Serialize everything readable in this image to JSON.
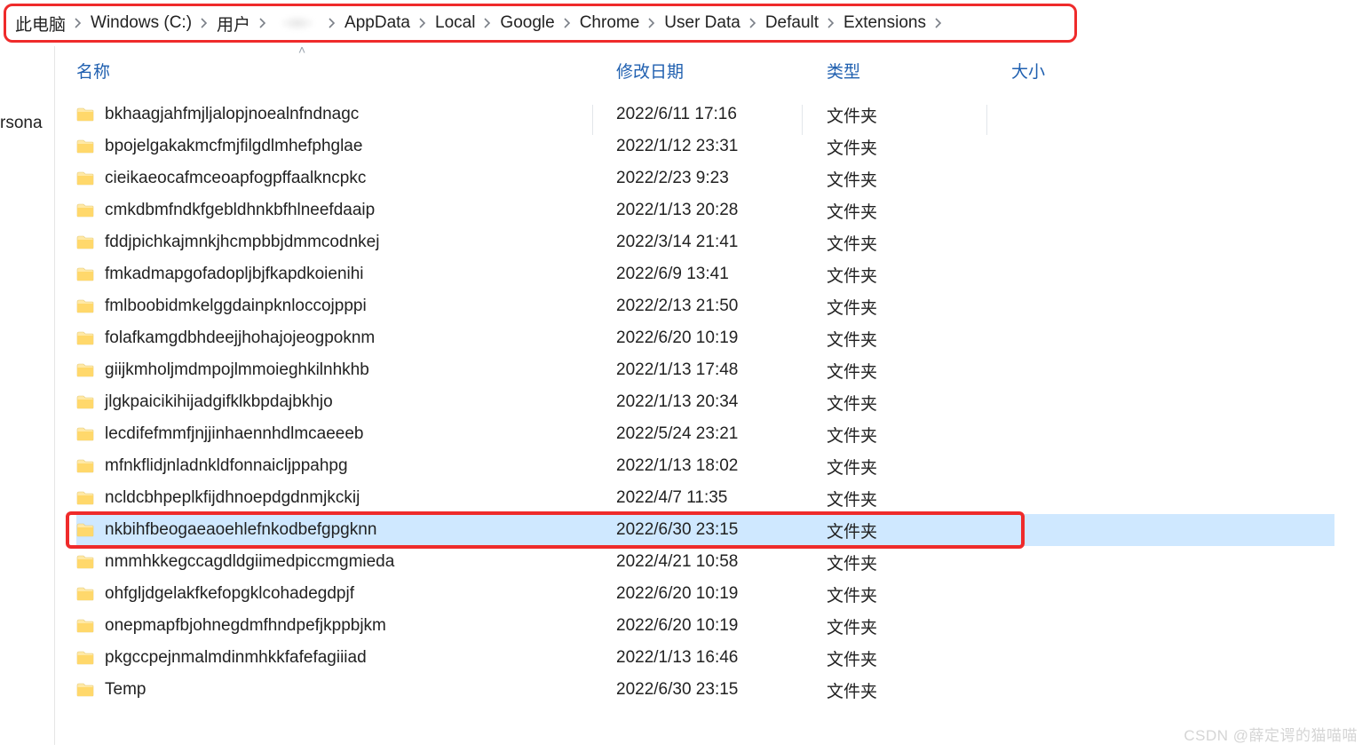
{
  "breadcrumb": [
    "此电脑",
    "Windows (C:)",
    "用户",
    "",
    "AppData",
    "Local",
    "Google",
    "Chrome",
    "User Data",
    "Default",
    "Extensions"
  ],
  "sidebar": {
    "item_partial": "rsona"
  },
  "columns": {
    "name": "名称",
    "date": "修改日期",
    "type": "类型",
    "size": "大小"
  },
  "rows": [
    {
      "name": "bkhaagjahfmjljalopjnoealnfndnagc",
      "date": "2022/6/11 17:16",
      "type": "文件夹",
      "selected": false
    },
    {
      "name": "bpojelgakakmcfmjfilgdlmhefphglae",
      "date": "2022/1/12 23:31",
      "type": "文件夹",
      "selected": false
    },
    {
      "name": "cieikaeocafmceoapfogpffaalkncpkc",
      "date": "2022/2/23 9:23",
      "type": "文件夹",
      "selected": false
    },
    {
      "name": "cmkdbmfndkfgebldhnkbfhlneefdaaip",
      "date": "2022/1/13 20:28",
      "type": "文件夹",
      "selected": false
    },
    {
      "name": "fddjpichkajmnkjhcmpbbjdmmcodnkej",
      "date": "2022/3/14 21:41",
      "type": "文件夹",
      "selected": false
    },
    {
      "name": "fmkadmapgofadopljbjfkapdkoienihi",
      "date": "2022/6/9 13:41",
      "type": "文件夹",
      "selected": false
    },
    {
      "name": "fmlboobidmkelggdainpknloccojpppi",
      "date": "2022/2/13 21:50",
      "type": "文件夹",
      "selected": false
    },
    {
      "name": "folafkamgdbhdeejjhohajojeogpoknm",
      "date": "2022/6/20 10:19",
      "type": "文件夹",
      "selected": false
    },
    {
      "name": "giijkmholjmdmpojlmmoieghkilnhkhb",
      "date": "2022/1/13 17:48",
      "type": "文件夹",
      "selected": false
    },
    {
      "name": "jlgkpaicikihijadgifklkbpdajbkhjo",
      "date": "2022/1/13 20:34",
      "type": "文件夹",
      "selected": false
    },
    {
      "name": "lecdifefmmfjnjjinhaennhdlmcaeeeb",
      "date": "2022/5/24 23:21",
      "type": "文件夹",
      "selected": false
    },
    {
      "name": "mfnkflidjnladnkldfonnaicljppahpg",
      "date": "2022/1/13 18:02",
      "type": "文件夹",
      "selected": false
    },
    {
      "name": "ncldcbhpeplkfijdhnoepdgdnmjkckij",
      "date": "2022/4/7 11:35",
      "type": "文件夹",
      "selected": false
    },
    {
      "name": "nkbihfbeogaeaoehlefnkodbefgpgknn",
      "date": "2022/6/30 23:15",
      "type": "文件夹",
      "selected": true
    },
    {
      "name": "nmmhkkegccagdldgiimedpiccmgmieda",
      "date": "2022/4/21 10:58",
      "type": "文件夹",
      "selected": false
    },
    {
      "name": "ohfgljdgelakfkefopgklcohadegdpjf",
      "date": "2022/6/20 10:19",
      "type": "文件夹",
      "selected": false
    },
    {
      "name": "onepmapfbjohnegdmfhndpefjkppbjkm",
      "date": "2022/6/20 10:19",
      "type": "文件夹",
      "selected": false
    },
    {
      "name": "pkgccpejnmalmdinmhkkfafefagiiiad",
      "date": "2022/1/13 16:46",
      "type": "文件夹",
      "selected": false
    },
    {
      "name": "Temp",
      "date": "2022/6/30 23:15",
      "type": "文件夹",
      "selected": false
    }
  ],
  "watermark": "CSDN @薛定谔的猫喵喵"
}
